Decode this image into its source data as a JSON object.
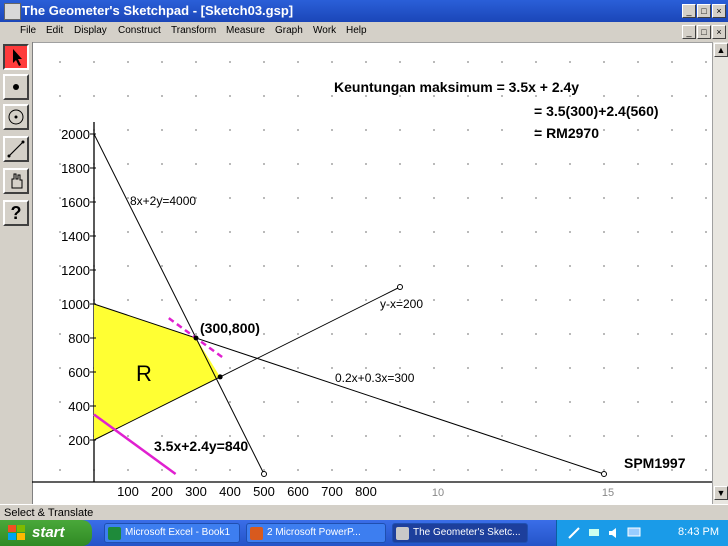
{
  "window": {
    "title": "The Geometer's Sketchpad - [Sketch03.gsp]",
    "controls": {
      "minimize": "_",
      "maximize": "□",
      "close": "×"
    }
  },
  "menubar": {
    "items": [
      "File",
      "Edit",
      "Display",
      "Construct",
      "Transform",
      "Measure",
      "Graph",
      "Work",
      "Help"
    ]
  },
  "toolbox": {
    "tools": [
      "selection-arrow-tool",
      "point-tool",
      "compass-tool",
      "straightedge-tool",
      "text-tool",
      "help-tool"
    ],
    "help_label": "?"
  },
  "sketch": {
    "profit_text": [
      "Keuntungan maksimum = 3.5x + 2.4y",
      "= 3.5(300)+2.4(560)",
      "= RM2970"
    ],
    "line_labels": {
      "line1": "8x+2y=4000",
      "line2": "y-x=200",
      "line3": "0.2x+0.3x=300",
      "objective": "3.5x+2.4y=840"
    },
    "optimum_point_label": "(300,800)",
    "region_label": "R",
    "source_label": "SPM1997",
    "y_ticks": [
      "2000",
      "1800",
      "1600",
      "1400",
      "1200",
      "1000",
      "800",
      "600",
      "400",
      "200"
    ],
    "x_ticks": [
      "100",
      "200",
      "300",
      "400",
      "500",
      "600",
      "700",
      "800"
    ],
    "x_ticks_grey": [
      "10",
      "15"
    ],
    "region_color": "#ffff33",
    "objective_color": "#e020d0"
  },
  "chart_data": {
    "type": "line",
    "x_range": [
      0,
      1000
    ],
    "y_range": [
      0,
      2000
    ],
    "series": [
      {
        "name": "8x+2y=4000",
        "x": [
          0,
          500
        ],
        "y": [
          2000,
          0
        ]
      },
      {
        "name": "y-x=200",
        "x": [
          0,
          900
        ],
        "y": [
          200,
          1100
        ]
      },
      {
        "name": "0.2x+0.3x=300",
        "x": [
          0,
          1500
        ],
        "y": [
          1000,
          0
        ]
      },
      {
        "name": "3.5x+2.4y=840",
        "x": [
          0,
          240
        ],
        "y": [
          350,
          0
        ]
      }
    ],
    "region_vertices": [
      [
        0,
        200
      ],
      [
        0,
        1000
      ],
      [
        300,
        800
      ],
      [
        371,
        571
      ]
    ],
    "optimum_point": {
      "x": 300,
      "y": 800
    }
  },
  "status": {
    "text": "Select & Translate"
  },
  "taskbar": {
    "start_label": "start",
    "items": [
      {
        "label": "Microsoft Excel - Book1",
        "active": false
      },
      {
        "label": "2 Microsoft PowerP...",
        "active": false
      },
      {
        "label": "The Geometer's Sketc...",
        "active": true
      }
    ],
    "clock": "8:43 PM"
  }
}
